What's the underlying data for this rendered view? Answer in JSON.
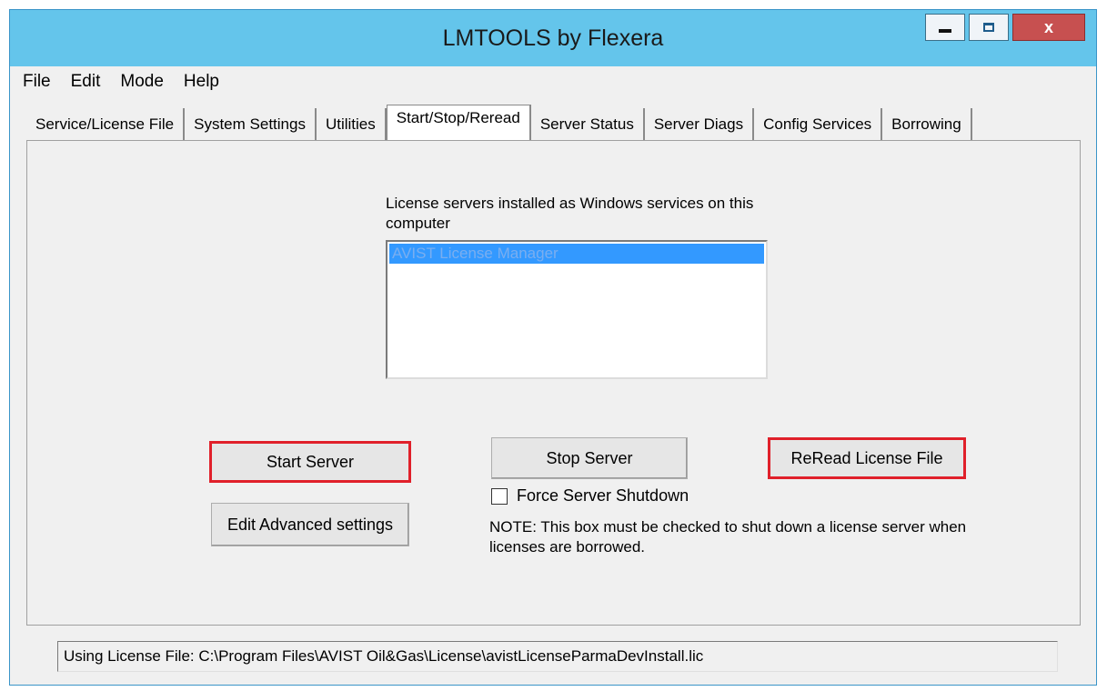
{
  "window": {
    "title": "LMTOOLS by Flexera",
    "close_label": "x"
  },
  "menu": [
    "File",
    "Edit",
    "Mode",
    "Help"
  ],
  "tabs": [
    "Service/License File",
    "System Settings",
    "Utilities",
    "Start/Stop/Reread",
    "Server Status",
    "Server Diags",
    "Config Services",
    "Borrowing"
  ],
  "active_tab": "Start/Stop/Reread",
  "services": {
    "caption": "License servers installed as Windows services on this computer",
    "items": [
      "AVIST License Manager"
    ],
    "selected": "AVIST License Manager"
  },
  "buttons": {
    "start": "Start Server",
    "stop": "Stop Server",
    "reread": "ReRead License File",
    "advanced": "Edit Advanced settings"
  },
  "force_shutdown": {
    "label": "Force Server Shutdown",
    "checked": false
  },
  "note": "NOTE:  This box must be checked to shut down a license server when licenses are borrowed.",
  "status": "Using License File:  C:\\Program Files\\AVIST Oil&Gas\\License\\avistLicenseParmaDevInstall.lic",
  "colors": {
    "titlebar": "#64c5eb",
    "highlight_border": "#e0202a",
    "selection": "#3399ff"
  }
}
